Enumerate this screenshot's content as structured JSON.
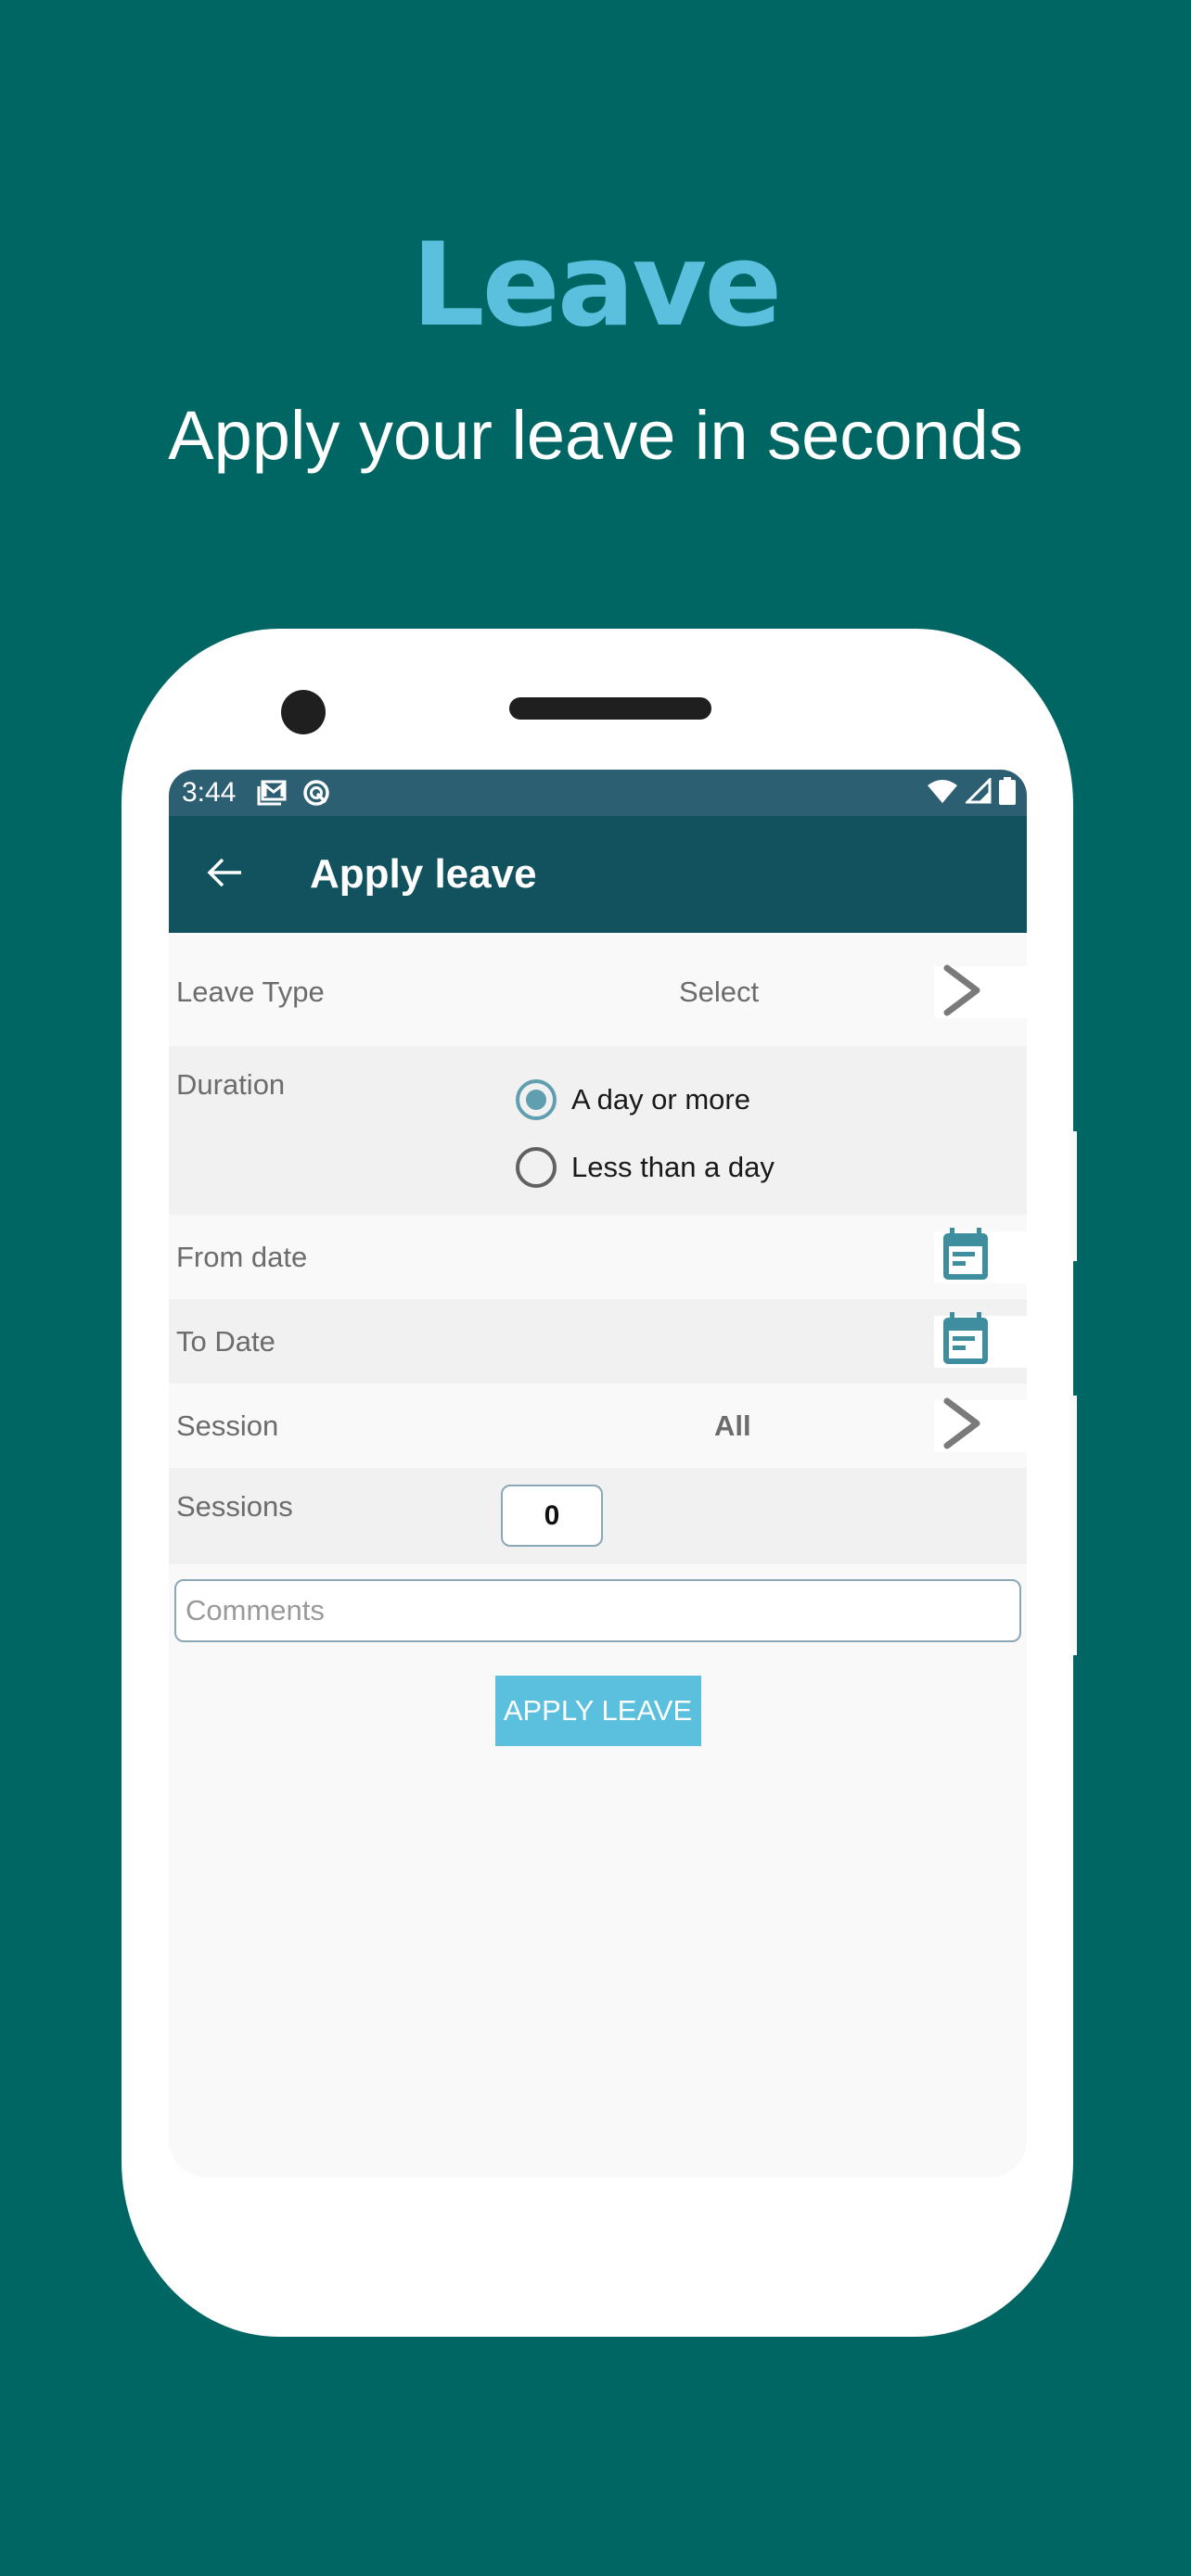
{
  "hero": {
    "title": "Leave",
    "subtitle": "Apply your leave in seconds"
  },
  "colors": {
    "background": "#006664",
    "accent": "#5bc0de",
    "app_bar": "#12525f",
    "status_bar": "#2d5f72",
    "radio_selected": "#5f9fb0",
    "calendar_icon": "#3f8ea0"
  },
  "status_bar": {
    "time": "3:44",
    "left_icons": [
      "gmail-icon",
      "sync-icon"
    ],
    "right_icons": [
      "wifi-icon",
      "cellular-signal-icon",
      "battery-icon"
    ]
  },
  "app_bar": {
    "back_icon": "arrow-left-icon",
    "title": "Apply leave"
  },
  "form": {
    "leave_type": {
      "label": "Leave Type",
      "value": "Select",
      "action_icon": "chevron-right-icon"
    },
    "duration": {
      "label": "Duration",
      "options": [
        {
          "label": "A day or more",
          "selected": true
        },
        {
          "label": "Less than a day",
          "selected": false
        }
      ]
    },
    "from_date": {
      "label": "From date",
      "action_icon": "calendar-icon"
    },
    "to_date": {
      "label": "To Date",
      "action_icon": "calendar-icon"
    },
    "session": {
      "label": "Session",
      "value": "All",
      "action_icon": "chevron-right-icon"
    },
    "sessions": {
      "label": "Sessions",
      "value": "0"
    },
    "comments": {
      "placeholder": "Comments",
      "value": ""
    },
    "submit_label": "APPLY LEAVE"
  }
}
